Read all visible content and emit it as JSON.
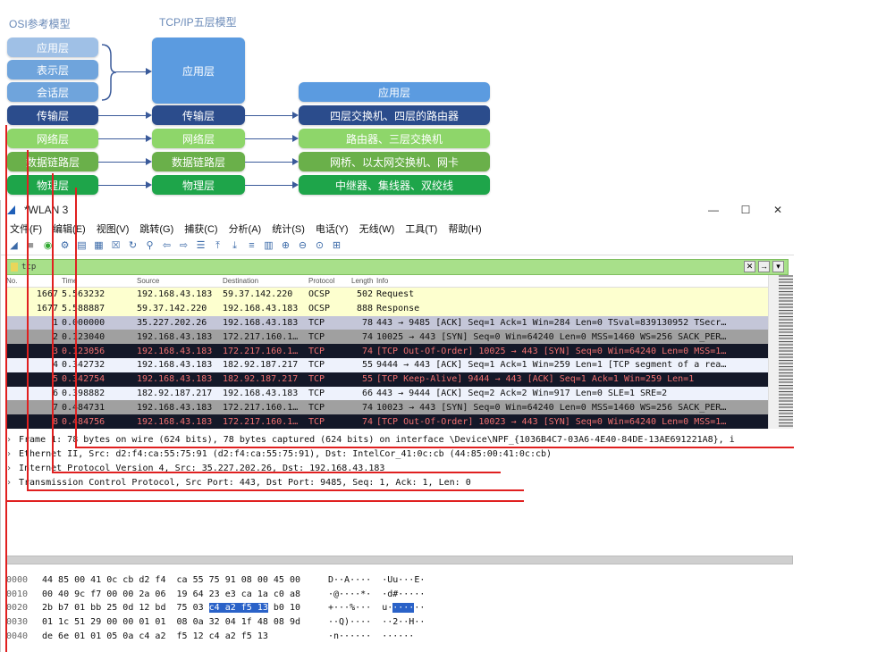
{
  "diagram": {
    "osi_title": "OSI参考模型",
    "tcpip_title": "TCP/IP五层模型",
    "osi": [
      "应用层",
      "表示层",
      "会话层",
      "传输层",
      "网络层",
      "数据链路层",
      "物理层"
    ],
    "tcpip": [
      "应用层",
      "传输层",
      "网络层",
      "数据链路层",
      "物理层"
    ],
    "devices": [
      "应用层",
      "四层交换机、四层的路由器",
      "路由器、三层交换机",
      "网桥、以太网交换机、网卡",
      "中继器、集线器、双绞线"
    ]
  },
  "window": {
    "title": "*WLAN 3",
    "minimize": "—",
    "maximize": "☐",
    "close": "✕"
  },
  "menu": [
    "文件(F)",
    "编辑(E)",
    "视图(V)",
    "跳转(G)",
    "捕获(C)",
    "分析(A)",
    "统计(S)",
    "电话(Y)",
    "无线(W)",
    "工具(T)",
    "帮助(H)"
  ],
  "filter": {
    "value": "tcp"
  },
  "columns": {
    "no": "No.",
    "time": "Time",
    "source": "Source",
    "destination": "Destination",
    "protocol": "Protocol",
    "length": "Length",
    "info": "Info"
  },
  "packets": [
    {
      "no": "1667",
      "time": "5.563232",
      "src": "192.168.43.183",
      "dst": "59.37.142.220",
      "proto": "OCSP",
      "len": "502",
      "info": "Request"
    },
    {
      "no": "1677",
      "time": "5.588887",
      "src": "59.37.142.220",
      "dst": "192.168.43.183",
      "proto": "OCSP",
      "len": "888",
      "info": "Response"
    },
    {
      "no": "1",
      "time": "0.000000",
      "src": "35.227.202.26",
      "dst": "192.168.43.183",
      "proto": "TCP",
      "len": "78",
      "info": "443 → 9485 [ACK] Seq=1 Ack=1 Win=284 Len=0 TSval=839130952 TSecr…"
    },
    {
      "no": "2",
      "time": "0.123040",
      "src": "192.168.43.183",
      "dst": "172.217.160.1…",
      "proto": "TCP",
      "len": "74",
      "info": "10025 → 443 [SYN] Seq=0 Win=64240 Len=0 MSS=1460 WS=256 SACK_PER…"
    },
    {
      "no": "3",
      "time": "0.123056",
      "src": "192.168.43.183",
      "dst": "172.217.160.1…",
      "proto": "TCP",
      "len": "74",
      "info": "[TCP Out-Of-Order] 10025 → 443 [SYN] Seq=0 Win=64240 Len=0 MSS=1…"
    },
    {
      "no": "4",
      "time": "0.342732",
      "src": "192.168.43.183",
      "dst": "182.92.187.217",
      "proto": "TCP",
      "len": "55",
      "info": "9444 → 443 [ACK] Seq=1 Ack=1 Win=259 Len=1 [TCP segment of a rea…"
    },
    {
      "no": "5",
      "time": "0.342754",
      "src": "192.168.43.183",
      "dst": "182.92.187.217",
      "proto": "TCP",
      "len": "55",
      "info": "[TCP Keep-Alive] 9444 → 443 [ACK] Seq=1 Ack=1 Win=259 Len=1"
    },
    {
      "no": "6",
      "time": "0.398882",
      "src": "182.92.187.217",
      "dst": "192.168.43.183",
      "proto": "TCP",
      "len": "66",
      "info": "443 → 9444 [ACK] Seq=2 Ack=2 Win=917 Len=0 SLE=1 SRE=2"
    },
    {
      "no": "7",
      "time": "0.484731",
      "src": "192.168.43.183",
      "dst": "172.217.160.1…",
      "proto": "TCP",
      "len": "74",
      "info": "10023 → 443 [SYN] Seq=0 Win=64240 Len=0 MSS=1460 WS=256 SACK_PER…"
    },
    {
      "no": "8",
      "time": "0.484756",
      "src": "192.168.43.183",
      "dst": "172.217.160.1…",
      "proto": "TCP",
      "len": "74",
      "info": "[TCP Out-Of-Order] 10023 → 443 [SYN] Seq=0 Win=64240 Len=0 MSS=1…"
    }
  ],
  "details": [
    "Frame 1: 78 bytes on wire (624 bits), 78 bytes captured (624 bits) on interface \\Device\\NPF_{1036B4C7-03A6-4E40-84DE-13AE691221A8}, i",
    "Ethernet II, Src: d2:f4:ca:55:75:91 (d2:f4:ca:55:75:91), Dst: IntelCor_41:0c:cb (44:85:00:41:0c:cb)",
    "Internet Protocol Version 4, Src: 35.227.202.26, Dst: 192.168.43.183",
    "Transmission Control Protocol, Src Port: 443, Dst Port: 9485, Seq: 1, Ack: 1, Len: 0"
  ],
  "hex": [
    {
      "off": "0000",
      "pre": "44 85 00 41 0c cb d2 f4  ca 55 75 91 08 00 45 00",
      "hl": "",
      "post": "",
      "apre": "D··A····  ·Uu···E·",
      "ahl": "",
      "apost": ""
    },
    {
      "off": "0010",
      "pre": "00 40 9c f7 00 00 2a 06  19 64 23 e3 ca 1a c0 a8",
      "hl": "",
      "post": "",
      "apre": "·@····*·  ·d#·····",
      "ahl": "",
      "apost": ""
    },
    {
      "off": "0020",
      "pre": "2b b7 01 bb 25 0d 12 bd  75 03 ",
      "hl": "c4 a2 f5 13",
      "post": " b0 10",
      "apre": "+···%···  u·",
      "ahl": "····",
      "apost": "··"
    },
    {
      "off": "0030",
      "pre": "01 1c 51 29 00 00 01 01  08 0a 32 04 1f 48 08 9d",
      "hl": "",
      "post": "",
      "apre": "··Q)····  ··2··H··",
      "ahl": "",
      "apost": ""
    },
    {
      "off": "0040",
      "pre": "de 6e 01 01 05 0a c4 a2  f5 12 c4 a2 f5 13",
      "hl": "",
      "post": "",
      "apre": "·n······  ······",
      "ahl": "",
      "apost": ""
    }
  ]
}
